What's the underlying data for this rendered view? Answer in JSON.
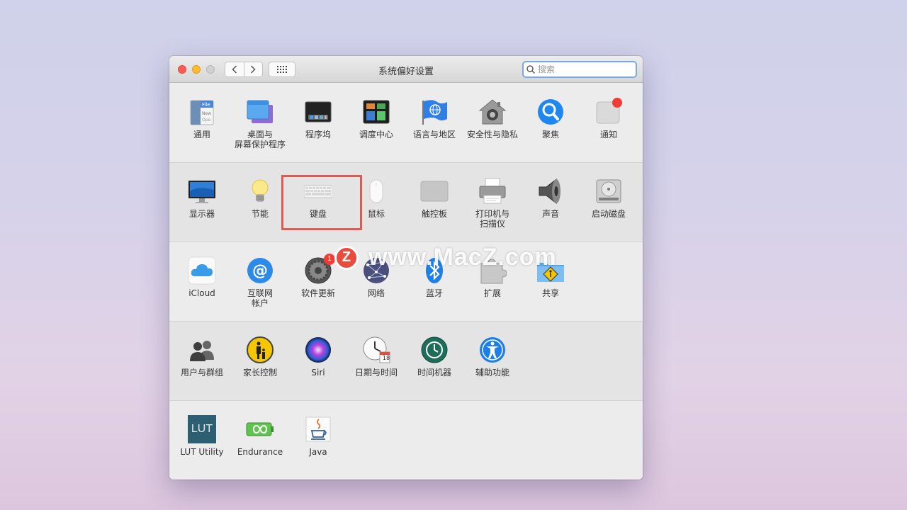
{
  "window": {
    "title": "系统偏好设置"
  },
  "search": {
    "placeholder": "搜索"
  },
  "colors": {
    "accent": "#7aa7e5",
    "highlight": "#e05a51",
    "badge": "#f23b35"
  },
  "rows": [
    [
      {
        "label": "通用",
        "icon": "general-file-icon"
      },
      {
        "label": "桌面与\n屏幕保护程序",
        "icon": "desktop-screensaver-icon"
      },
      {
        "label": "程序坞",
        "icon": "dock-icon"
      },
      {
        "label": "调度中心",
        "icon": "mission-control-icon"
      },
      {
        "label": "语言与地区",
        "icon": "language-flag-icon"
      },
      {
        "label": "安全性与隐私",
        "icon": "security-house-icon"
      },
      {
        "label": "聚焦",
        "icon": "spotlight-magnifier-icon"
      },
      {
        "label": "通知",
        "icon": "notifications-icon"
      }
    ],
    [
      {
        "label": "显示器",
        "icon": "display-icon"
      },
      {
        "label": "节能",
        "icon": "energy-bulb-icon"
      },
      {
        "label": "键盘",
        "icon": "keyboard-icon"
      },
      {
        "label": "鼠标",
        "icon": "mouse-icon"
      },
      {
        "label": "触控板",
        "icon": "trackpad-icon"
      },
      {
        "label": "打印机与\n扫描仪",
        "icon": "printer-icon"
      },
      {
        "label": "声音",
        "icon": "speaker-icon"
      },
      {
        "label": "启动磁盘",
        "icon": "disk-icon"
      }
    ],
    [
      {
        "label": "iCloud",
        "icon": "icloud-icon"
      },
      {
        "label": "互联网\n帐户",
        "icon": "internet-accounts-at-icon"
      },
      {
        "label": "软件更新",
        "icon": "software-update-gear-icon",
        "badge": "1"
      },
      {
        "label": "网络",
        "icon": "network-globe-icon"
      },
      {
        "label": "蓝牙",
        "icon": "bluetooth-icon"
      },
      {
        "label": "扩展",
        "icon": "extensions-puzzle-icon"
      },
      {
        "label": "共享",
        "icon": "sharing-folder-icon"
      }
    ],
    [
      {
        "label": "用户与群组",
        "icon": "users-groups-icon"
      },
      {
        "label": "家长控制",
        "icon": "parental-controls-icon"
      },
      {
        "label": "Siri",
        "icon": "siri-icon"
      },
      {
        "label": "日期与时间",
        "icon": "date-time-clock-icon",
        "day": "18"
      },
      {
        "label": "时间机器",
        "icon": "time-machine-icon"
      },
      {
        "label": "辅助功能",
        "icon": "accessibility-icon"
      }
    ],
    [
      {
        "label": "LUT Utility",
        "icon": "lut-utility-icon",
        "text": "LUT"
      },
      {
        "label": "Endurance",
        "icon": "endurance-battery-icon"
      },
      {
        "label": "Java",
        "icon": "java-cup-icon"
      }
    ]
  ],
  "watermark": {
    "logo": "Z",
    "text": "www.MacZ.com"
  }
}
